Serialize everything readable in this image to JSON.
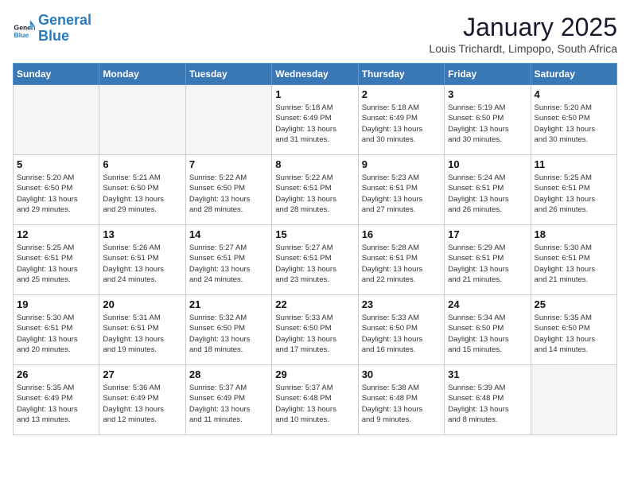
{
  "header": {
    "logo_text_general": "General",
    "logo_text_blue": "Blue",
    "title": "January 2025",
    "subtitle": "Louis Trichardt, Limpopo, South Africa"
  },
  "days_of_week": [
    "Sunday",
    "Monday",
    "Tuesday",
    "Wednesday",
    "Thursday",
    "Friday",
    "Saturday"
  ],
  "weeks": [
    [
      {
        "day": "",
        "info": ""
      },
      {
        "day": "",
        "info": ""
      },
      {
        "day": "",
        "info": ""
      },
      {
        "day": "1",
        "info": "Sunrise: 5:18 AM\nSunset: 6:49 PM\nDaylight: 13 hours\nand 31 minutes."
      },
      {
        "day": "2",
        "info": "Sunrise: 5:18 AM\nSunset: 6:49 PM\nDaylight: 13 hours\nand 30 minutes."
      },
      {
        "day": "3",
        "info": "Sunrise: 5:19 AM\nSunset: 6:50 PM\nDaylight: 13 hours\nand 30 minutes."
      },
      {
        "day": "4",
        "info": "Sunrise: 5:20 AM\nSunset: 6:50 PM\nDaylight: 13 hours\nand 30 minutes."
      }
    ],
    [
      {
        "day": "5",
        "info": "Sunrise: 5:20 AM\nSunset: 6:50 PM\nDaylight: 13 hours\nand 29 minutes."
      },
      {
        "day": "6",
        "info": "Sunrise: 5:21 AM\nSunset: 6:50 PM\nDaylight: 13 hours\nand 29 minutes."
      },
      {
        "day": "7",
        "info": "Sunrise: 5:22 AM\nSunset: 6:50 PM\nDaylight: 13 hours\nand 28 minutes."
      },
      {
        "day": "8",
        "info": "Sunrise: 5:22 AM\nSunset: 6:51 PM\nDaylight: 13 hours\nand 28 minutes."
      },
      {
        "day": "9",
        "info": "Sunrise: 5:23 AM\nSunset: 6:51 PM\nDaylight: 13 hours\nand 27 minutes."
      },
      {
        "day": "10",
        "info": "Sunrise: 5:24 AM\nSunset: 6:51 PM\nDaylight: 13 hours\nand 26 minutes."
      },
      {
        "day": "11",
        "info": "Sunrise: 5:25 AM\nSunset: 6:51 PM\nDaylight: 13 hours\nand 26 minutes."
      }
    ],
    [
      {
        "day": "12",
        "info": "Sunrise: 5:25 AM\nSunset: 6:51 PM\nDaylight: 13 hours\nand 25 minutes."
      },
      {
        "day": "13",
        "info": "Sunrise: 5:26 AM\nSunset: 6:51 PM\nDaylight: 13 hours\nand 24 minutes."
      },
      {
        "day": "14",
        "info": "Sunrise: 5:27 AM\nSunset: 6:51 PM\nDaylight: 13 hours\nand 24 minutes."
      },
      {
        "day": "15",
        "info": "Sunrise: 5:27 AM\nSunset: 6:51 PM\nDaylight: 13 hours\nand 23 minutes."
      },
      {
        "day": "16",
        "info": "Sunrise: 5:28 AM\nSunset: 6:51 PM\nDaylight: 13 hours\nand 22 minutes."
      },
      {
        "day": "17",
        "info": "Sunrise: 5:29 AM\nSunset: 6:51 PM\nDaylight: 13 hours\nand 21 minutes."
      },
      {
        "day": "18",
        "info": "Sunrise: 5:30 AM\nSunset: 6:51 PM\nDaylight: 13 hours\nand 21 minutes."
      }
    ],
    [
      {
        "day": "19",
        "info": "Sunrise: 5:30 AM\nSunset: 6:51 PM\nDaylight: 13 hours\nand 20 minutes."
      },
      {
        "day": "20",
        "info": "Sunrise: 5:31 AM\nSunset: 6:51 PM\nDaylight: 13 hours\nand 19 minutes."
      },
      {
        "day": "21",
        "info": "Sunrise: 5:32 AM\nSunset: 6:50 PM\nDaylight: 13 hours\nand 18 minutes."
      },
      {
        "day": "22",
        "info": "Sunrise: 5:33 AM\nSunset: 6:50 PM\nDaylight: 13 hours\nand 17 minutes."
      },
      {
        "day": "23",
        "info": "Sunrise: 5:33 AM\nSunset: 6:50 PM\nDaylight: 13 hours\nand 16 minutes."
      },
      {
        "day": "24",
        "info": "Sunrise: 5:34 AM\nSunset: 6:50 PM\nDaylight: 13 hours\nand 15 minutes."
      },
      {
        "day": "25",
        "info": "Sunrise: 5:35 AM\nSunset: 6:50 PM\nDaylight: 13 hours\nand 14 minutes."
      }
    ],
    [
      {
        "day": "26",
        "info": "Sunrise: 5:35 AM\nSunset: 6:49 PM\nDaylight: 13 hours\nand 13 minutes."
      },
      {
        "day": "27",
        "info": "Sunrise: 5:36 AM\nSunset: 6:49 PM\nDaylight: 13 hours\nand 12 minutes."
      },
      {
        "day": "28",
        "info": "Sunrise: 5:37 AM\nSunset: 6:49 PM\nDaylight: 13 hours\nand 11 minutes."
      },
      {
        "day": "29",
        "info": "Sunrise: 5:37 AM\nSunset: 6:48 PM\nDaylight: 13 hours\nand 10 minutes."
      },
      {
        "day": "30",
        "info": "Sunrise: 5:38 AM\nSunset: 6:48 PM\nDaylight: 13 hours\nand 9 minutes."
      },
      {
        "day": "31",
        "info": "Sunrise: 5:39 AM\nSunset: 6:48 PM\nDaylight: 13 hours\nand 8 minutes."
      },
      {
        "day": "",
        "info": ""
      }
    ]
  ]
}
